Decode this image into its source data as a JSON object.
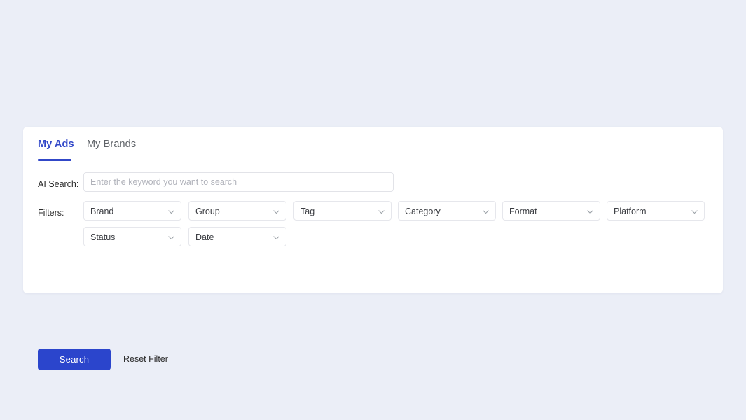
{
  "tabs": [
    {
      "label": "My Ads",
      "active": true
    },
    {
      "label": "My Brands",
      "active": false
    }
  ],
  "search_row": {
    "label": "AI Search:",
    "placeholder": "Enter the keyword you want to search",
    "value": ""
  },
  "filters_row": {
    "label": "Filters:",
    "dropdowns_row1": [
      {
        "label": "Brand",
        "icon": "chevron-down-icon"
      },
      {
        "label": "Group",
        "icon": "chevron-down-icon"
      },
      {
        "label": "Tag",
        "icon": "chevron-down-icon"
      },
      {
        "label": "Category",
        "icon": "chevron-down-icon"
      },
      {
        "label": "Format",
        "icon": "chevron-down-icon"
      },
      {
        "label": "Platform",
        "icon": "chevron-down-icon"
      }
    ],
    "dropdowns_row2": [
      {
        "label": "Status",
        "icon": "chevron-down-icon"
      },
      {
        "label": "Date",
        "icon": "chevron-down-icon"
      }
    ]
  },
  "actions": {
    "search_label": "Search",
    "reset_label": "Reset Filter"
  },
  "colors": {
    "page_background": "#ebeef7",
    "card_background": "#ffffff",
    "accent_blue": "#3147c8",
    "button_blue": "#2b45cc",
    "tab_inactive": "#5f6368",
    "border": "#e6e7ec",
    "placeholder": "#b0b2ba"
  }
}
